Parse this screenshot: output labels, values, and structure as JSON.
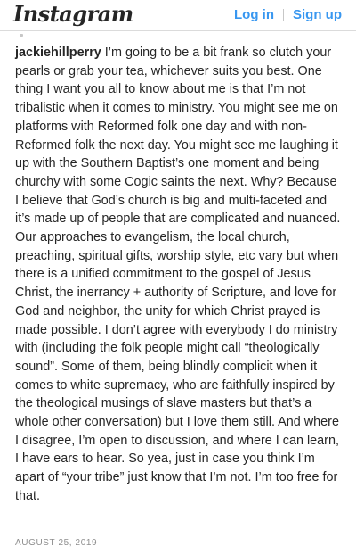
{
  "header": {
    "logo_text": "Instagram",
    "login_label": "Log in",
    "signup_label": "Sign up"
  },
  "post": {
    "username": "jackiehillperry",
    "caption": " I’m going to be a bit frank so clutch your pearls or grab your tea, whichever suits you best. One thing I want you all to know about me is that I’m not tribalistic when it comes to ministry. You might see me on platforms with Reformed folk one day and with non-Reformed folk the next day. You might see me laughing it up with the Southern Baptist’s one moment and being churchy with some Cogic saints the next. Why? Because I believe that God’s church is big and multi-faceted and it’s made up of people that are complicated and nuanced. Our approaches to evangelism, the local church, preaching, spiritual gifts, worship style, etc vary but when there is a unified commitment to the gospel of Jesus Christ, the inerrancy + authority of Scripture, and love for God and neighbor, the unity for which Christ prayed is made possible. I don’t agree with everybody I do ministry with (including the folk people might call “theologically sound”. Some of them, being blindly complicit when it comes to white supremacy, who are faithfully inspired by the theological musings of slave masters but that’s a whole other conversation) but I love them still. And where I disagree, I’m open to discussion, and where I can learn, I have ears to hear. So yea, just in case you think I’m apart of “your tribe” just know that I’m not. I’m too free for that.",
    "date": "AUGUST 25, 2019"
  },
  "colors": {
    "link_blue": "#3897f0",
    "text": "#262626",
    "muted": "#8e8e8e"
  }
}
